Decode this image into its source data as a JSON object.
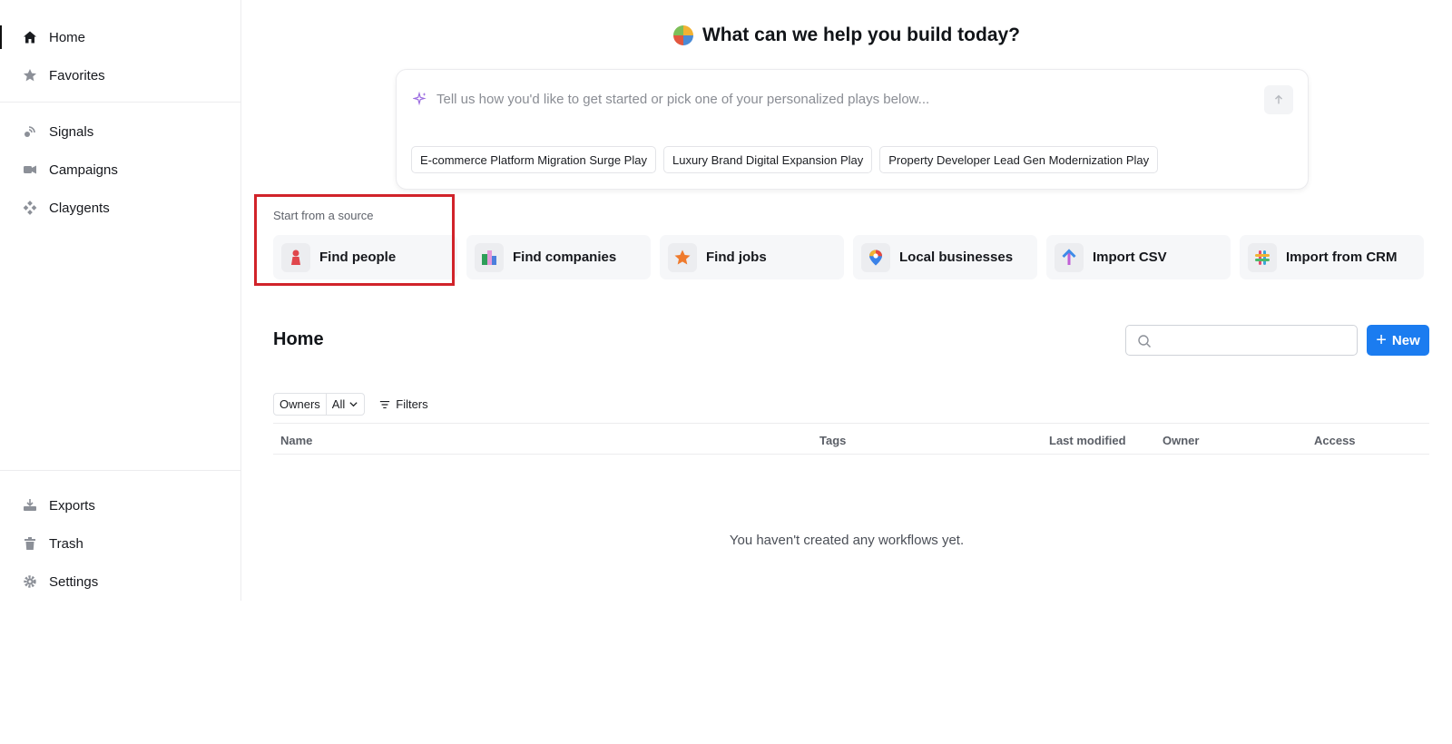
{
  "sidebar": {
    "top": [
      {
        "label": "Home",
        "icon": "home-icon",
        "active": true
      },
      {
        "label": "Favorites",
        "icon": "star-icon"
      }
    ],
    "middle": [
      {
        "label": "Signals",
        "icon": "signals-icon"
      },
      {
        "label": "Campaigns",
        "icon": "campaigns-icon"
      },
      {
        "label": "Claygents",
        "icon": "claygents-icon"
      }
    ],
    "bottom": [
      {
        "label": "Exports",
        "icon": "exports-icon"
      },
      {
        "label": "Trash",
        "icon": "trash-icon"
      },
      {
        "label": "Settings",
        "icon": "settings-icon"
      }
    ]
  },
  "hero": {
    "title": "What can we help you build today?",
    "prompt_placeholder": "Tell us how you'd like to get started or pick one of your personalized plays below...",
    "chips": [
      "E-commerce Platform Migration Surge Play",
      "Luxury Brand Digital Expansion Play",
      "Property Developer Lead Gen Modernization Play"
    ]
  },
  "sources": {
    "label": "Start from a source",
    "items": [
      {
        "label": "Find people",
        "icon": "person-icon"
      },
      {
        "label": "Find companies",
        "icon": "building-icon"
      },
      {
        "label": "Find jobs",
        "icon": "star-badge-icon"
      },
      {
        "label": "Local businesses",
        "icon": "map-pin-icon"
      },
      {
        "label": "Import CSV",
        "icon": "upload-arrow-icon"
      },
      {
        "label": "Import from CRM",
        "icon": "crm-grid-icon"
      }
    ]
  },
  "workflows": {
    "title": "Home",
    "search_placeholder": "",
    "new_label": "New",
    "owners_label": "Owners",
    "owners_value": "All",
    "filters_label": "Filters",
    "columns": [
      "Name",
      "Tags",
      "Last modified",
      "Owner",
      "Access"
    ],
    "empty_message": "You haven't created any workflows yet."
  },
  "colors": {
    "accent": "#1b7cf0",
    "highlight": "#d1232a"
  }
}
